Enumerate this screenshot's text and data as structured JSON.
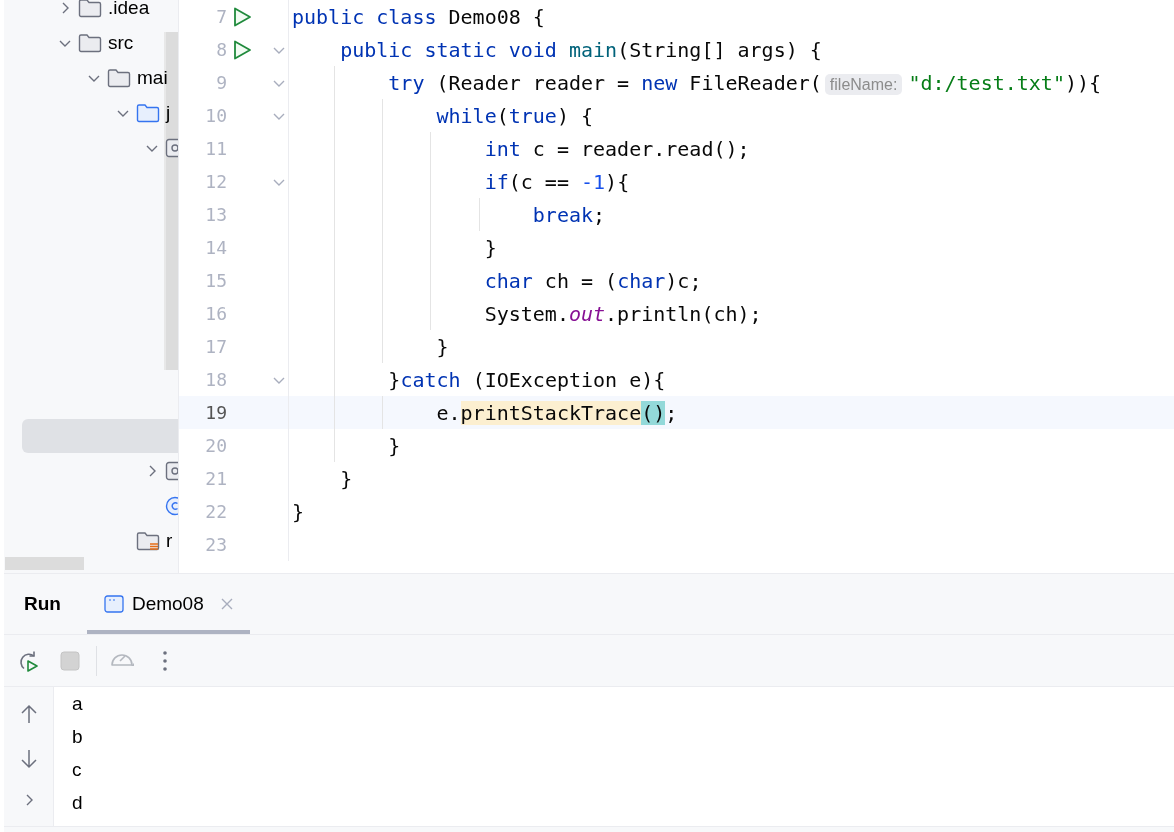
{
  "project_tree": [
    {
      "label": ".idea",
      "kind": "folder",
      "expanded": false,
      "selected": false
    },
    {
      "label": "src",
      "kind": "folder",
      "expanded": true,
      "selected": false,
      "children": [
        {
          "label": "mai",
          "kind": "folder",
          "expanded": true,
          "selected": false,
          "children": [
            {
              "label": "j",
              "kind": "source-folder",
              "expanded": true,
              "selected": false,
              "children": [
                {
                  "kind": "package",
                  "expanded": true,
                  "selected": false,
                  "children": [
                    {
                      "kind": "blank",
                      "selected": true
                    }
                  ]
                },
                {
                  "kind": "package",
                  "expanded": false,
                  "selected": false
                },
                {
                  "kind": "class",
                  "selected": false
                }
              ]
            },
            {
              "label": "r",
              "kind": "resources-folder",
              "selected": false
            }
          ]
        }
      ]
    }
  ],
  "editor": {
    "lines": [
      {
        "number": "7",
        "run": true,
        "fold": false,
        "current": false,
        "tokens": [
          {
            "kind": "keyword",
            "text": "public class"
          },
          {
            "kind": "plain",
            "text": " Demo08 {"
          }
        ]
      },
      {
        "number": "8",
        "run": true,
        "fold": true,
        "current": false,
        "tokens": [
          {
            "kind": "keyword",
            "text": "    public static void "
          },
          {
            "kind": "method",
            "text": "main"
          },
          {
            "kind": "plain",
            "text": "(String[] args) {"
          }
        ]
      },
      {
        "number": "9",
        "run": false,
        "fold": true,
        "current": false,
        "tokens": [
          {
            "kind": "keyword",
            "text": "        try"
          },
          {
            "kind": "plain",
            "text": " (Reader reader = "
          },
          {
            "kind": "keyword",
            "text": "new"
          },
          {
            "kind": "plain",
            "text": " FileReader("
          },
          {
            "kind": "hint",
            "text": "fileName:"
          },
          {
            "kind": "string",
            "text": "\"d:/test.txt\""
          },
          {
            "kind": "plain",
            "text": ")){"
          }
        ]
      },
      {
        "number": "10",
        "run": false,
        "fold": true,
        "current": false,
        "tokens": [
          {
            "kind": "keyword",
            "text": "            while"
          },
          {
            "kind": "plain",
            "text": "("
          },
          {
            "kind": "keyword",
            "text": "true"
          },
          {
            "kind": "plain",
            "text": ") {"
          }
        ]
      },
      {
        "number": "11",
        "run": false,
        "fold": false,
        "current": false,
        "tokens": [
          {
            "kind": "keyword",
            "text": "                int"
          },
          {
            "kind": "plain",
            "text": " c = reader.read();"
          }
        ]
      },
      {
        "number": "12",
        "run": false,
        "fold": true,
        "current": false,
        "tokens": [
          {
            "kind": "keyword",
            "text": "                if"
          },
          {
            "kind": "plain",
            "text": "(c == "
          },
          {
            "kind": "number",
            "text": "-1"
          },
          {
            "kind": "plain",
            "text": "){"
          }
        ]
      },
      {
        "number": "13",
        "run": false,
        "fold": false,
        "current": false,
        "tokens": [
          {
            "kind": "keyword",
            "text": "                    break"
          },
          {
            "kind": "plain",
            "text": ";"
          }
        ]
      },
      {
        "number": "14",
        "run": false,
        "fold": false,
        "current": false,
        "tokens": [
          {
            "kind": "plain",
            "text": "                }"
          }
        ]
      },
      {
        "number": "15",
        "run": false,
        "fold": false,
        "current": false,
        "tokens": [
          {
            "kind": "keyword",
            "text": "                char"
          },
          {
            "kind": "plain",
            "text": " ch = ("
          },
          {
            "kind": "keyword",
            "text": "char"
          },
          {
            "kind": "plain",
            "text": ")c;"
          }
        ]
      },
      {
        "number": "16",
        "run": false,
        "fold": false,
        "current": false,
        "tokens": [
          {
            "kind": "plain",
            "text": "                System."
          },
          {
            "kind": "static",
            "text": "out"
          },
          {
            "kind": "plain",
            "text": ".println(ch);"
          }
        ]
      },
      {
        "number": "17",
        "run": false,
        "fold": false,
        "current": false,
        "tokens": [
          {
            "kind": "plain",
            "text": "            }"
          }
        ]
      },
      {
        "number": "18",
        "run": false,
        "fold": true,
        "current": false,
        "tokens": [
          {
            "kind": "plain",
            "text": "        }"
          },
          {
            "kind": "keyword",
            "text": "catch"
          },
          {
            "kind": "plain",
            "text": " (IOException e){"
          }
        ]
      },
      {
        "number": "19",
        "run": false,
        "fold": false,
        "current": true,
        "tokens": [
          {
            "kind": "plain",
            "text": "            e."
          },
          {
            "kind": "usage",
            "text": "printStackTrace"
          },
          {
            "kind": "match",
            "text": "()"
          },
          {
            "kind": "plain",
            "text": ";"
          }
        ]
      },
      {
        "number": "20",
        "run": false,
        "fold": false,
        "current": false,
        "tokens": [
          {
            "kind": "plain",
            "text": "        }"
          }
        ]
      },
      {
        "number": "21",
        "run": false,
        "fold": false,
        "current": false,
        "tokens": [
          {
            "kind": "plain",
            "text": "    }"
          }
        ]
      },
      {
        "number": "22",
        "run": false,
        "fold": false,
        "current": false,
        "tokens": [
          {
            "kind": "plain",
            "text": "}"
          }
        ]
      },
      {
        "number": "23",
        "run": false,
        "fold": false,
        "current": false
      }
    ]
  },
  "run_panel": {
    "title": "Run",
    "tabs": [
      {
        "label": "Demo08",
        "selected": true,
        "closable": true
      }
    ],
    "toolbar": [
      {
        "kind": "rerun",
        "disabled": false
      },
      {
        "kind": "stop",
        "disabled": true
      },
      {
        "kind": "separator"
      },
      {
        "kind": "gauge",
        "disabled": true
      },
      {
        "kind": "more",
        "disabled": false
      }
    ],
    "side_tools": [
      {
        "kind": "up"
      },
      {
        "kind": "down"
      },
      {
        "kind": "expand"
      }
    ],
    "output": [
      "a",
      "b",
      "c",
      "d"
    ]
  }
}
